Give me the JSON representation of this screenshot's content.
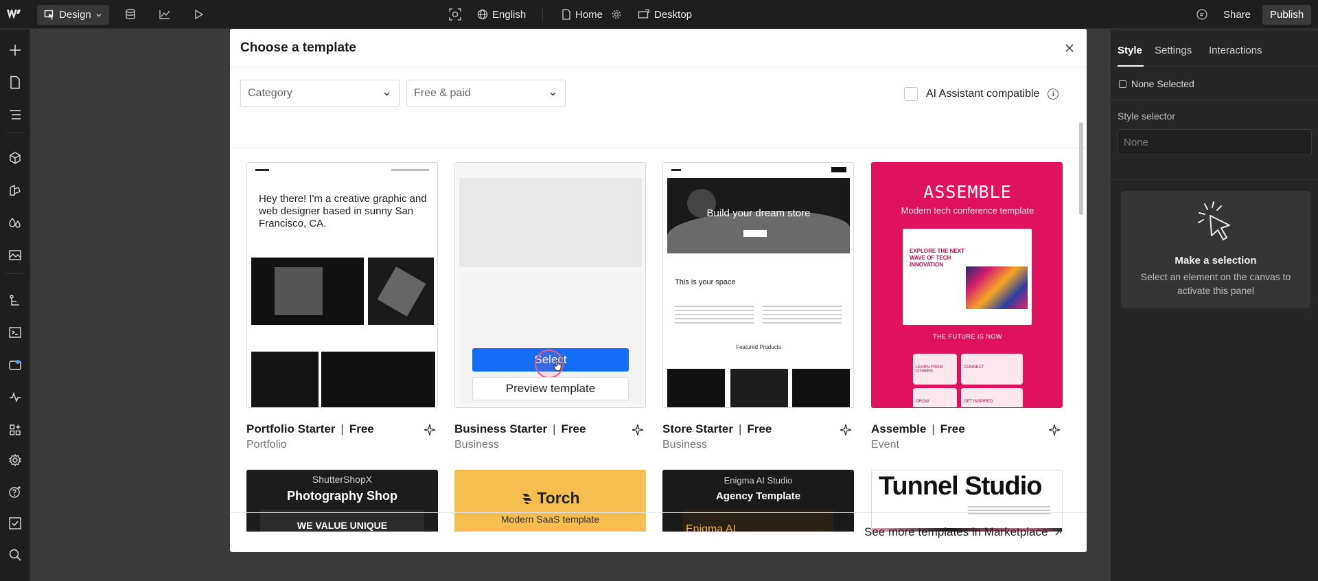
{
  "topbar": {
    "mode_label": "Design",
    "language_label": "English",
    "page_label": "Home",
    "breakpoint_label": "Desktop",
    "share_label": "Share",
    "publish_label": "Publish"
  },
  "modal": {
    "title": "Choose a template",
    "category_placeholder": "Category",
    "price_filter": "Free & paid",
    "ai_compatible_label": "AI Assistant compatible",
    "marketplace_link": "See more templates in Marketplace",
    "select_label": "Select",
    "preview_label": "Preview template",
    "templates": [
      {
        "name": "Portfolio Starter",
        "price": "Free",
        "category": "Portfolio",
        "thumb_heading": "Hey there! I'm a creative graphic and web designer based in sunny San Francisco, CA."
      },
      {
        "name": "Business Starter",
        "price": "Free",
        "category": "Business"
      },
      {
        "name": "Store Starter",
        "price": "Free",
        "category": "Business",
        "thumb_heading": "Build your dream store",
        "thumb_sub": "This is your space",
        "thumb_section": "Featured Products"
      },
      {
        "name": "Assemble",
        "price": "Free",
        "category": "Event",
        "thumb_heading": "ASSEMBLE",
        "thumb_sub": "Modern tech conference template",
        "thumb_inner": "EXPLORE THE NEXT WAVE OF TECH INNOVATION",
        "thumb_section": "THE FUTURE IS NOW",
        "thumb_cards": [
          "LEARN FROM OTHERS",
          "CONNECT",
          "GROW",
          "GET INSPIRED"
        ]
      }
    ],
    "row2": [
      {
        "brand": "ShutterShopX",
        "title": "Photography Shop",
        "tagline": "WE VALUE UNIQUE"
      },
      {
        "brand": "Torch",
        "title": "Modern SaaS template"
      },
      {
        "brand": "Enigma AI Studio",
        "title": "Agency Template",
        "tagline": "Enigma AI"
      },
      {
        "brand": "Tunnel Studio"
      }
    ]
  },
  "right_panel": {
    "tabs": [
      "Style",
      "Settings",
      "Interactions"
    ],
    "none_selected": "None Selected",
    "style_selector_label": "Style selector",
    "style_selector_placeholder": "None",
    "empty_title": "Make a selection",
    "empty_desc": "Select an element on the canvas to activate this panel"
  },
  "colors": {
    "accent_blue": "#146EF5",
    "assemble_pink": "#E0125E",
    "torch_yellow": "#F5BE4F"
  }
}
